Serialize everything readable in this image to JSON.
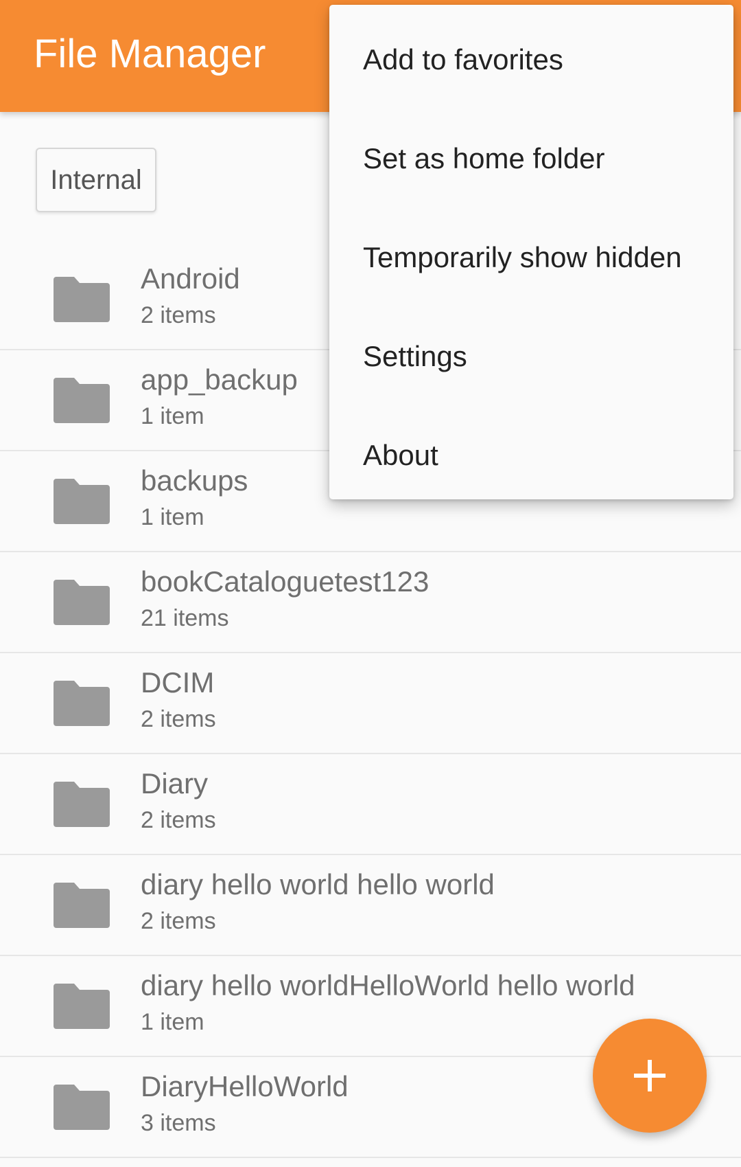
{
  "app_bar": {
    "title": "File Manager",
    "color": "#f68b32"
  },
  "storage_chip": {
    "label": "Internal"
  },
  "files": [
    {
      "name": "Android",
      "count": "2 items",
      "icon": "folder-icon"
    },
    {
      "name": "app_backup",
      "count": "1 item",
      "icon": "folder-icon"
    },
    {
      "name": "backups",
      "count": "1 item",
      "icon": "folder-icon"
    },
    {
      "name": "bookCataloguetest123",
      "count": "21 items",
      "icon": "folder-icon"
    },
    {
      "name": "DCIM",
      "count": "2 items",
      "icon": "folder-icon"
    },
    {
      "name": "Diary",
      "count": "2 items",
      "icon": "folder-icon"
    },
    {
      "name": "diary hello world hello world",
      "count": "2 items",
      "icon": "folder-icon"
    },
    {
      "name": "diary hello worldHelloWorld hello world",
      "count": "1 item",
      "icon": "folder-icon"
    },
    {
      "name": "DiaryHelloWorld",
      "count": "3 items",
      "icon": "folder-icon"
    }
  ],
  "overflow_menu": {
    "items": [
      {
        "label": "Add to favorites"
      },
      {
        "label": "Set as home folder"
      },
      {
        "label": "Temporarily show hidden"
      },
      {
        "label": "Settings"
      },
      {
        "label": "About"
      }
    ]
  },
  "fab": {
    "icon": "plus-icon",
    "color": "#f68b32"
  },
  "colors": {
    "folder_icon": "#9a9a9a",
    "text_secondary": "#6f6f6f",
    "divider": "#e6e6e6",
    "background": "#fafafa"
  }
}
